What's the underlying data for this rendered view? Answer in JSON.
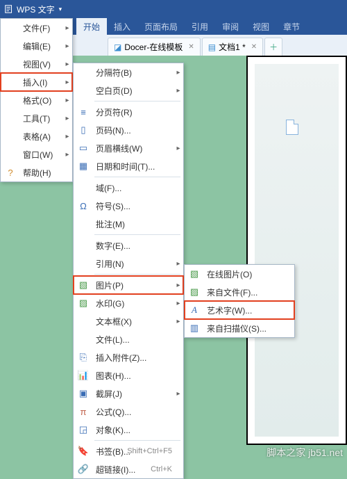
{
  "app": {
    "name": "WPS 文字"
  },
  "ribbon": {
    "tabs": [
      "开始",
      "插入",
      "页面布局",
      "引用",
      "审阅",
      "视图",
      "章节"
    ]
  },
  "docs": {
    "tab1": "Docer-在线模板",
    "tab2": "文档1 *"
  },
  "mainmenu": {
    "file": "文件(F)",
    "edit": "编辑(E)",
    "view": "视图(V)",
    "insert": "插入(I)",
    "format": "格式(O)",
    "tools": "工具(T)",
    "table": "表格(A)",
    "window": "窗口(W)",
    "help": "帮助(H)"
  },
  "insertmenu": {
    "separator": "分隔符(B)",
    "blank": "空白页(D)",
    "pagebreak": "分页符(R)",
    "pagenum": "页码(N)...",
    "headerline": "页眉横线(W)",
    "datetime": "日期和时间(T)...",
    "field": "域(F)...",
    "symbol": "符号(S)...",
    "comment": "批注(M)",
    "number": "数字(E)...",
    "reference": "引用(N)",
    "picture": "图片(P)",
    "watermark": "水印(G)",
    "textbox": "文本框(X)",
    "file": "文件(L)...",
    "attach": "插入附件(Z)...",
    "chart": "图表(H)...",
    "screenshot": "截屏(J)",
    "equation": "公式(Q)...",
    "object": "对象(K)...",
    "bookmark": "书签(B)...",
    "bookmark_short": "Shift+Ctrl+F5",
    "hyperlink": "超链接(I)...",
    "hyperlink_short": "Ctrl+K"
  },
  "picmenu": {
    "online": "在线图片(O)",
    "fromfile": "来自文件(F)...",
    "wordart": "艺术字(W)...",
    "scanner": "来自扫描仪(S)..."
  },
  "watermark_text": "脚本之家 jb51.net"
}
